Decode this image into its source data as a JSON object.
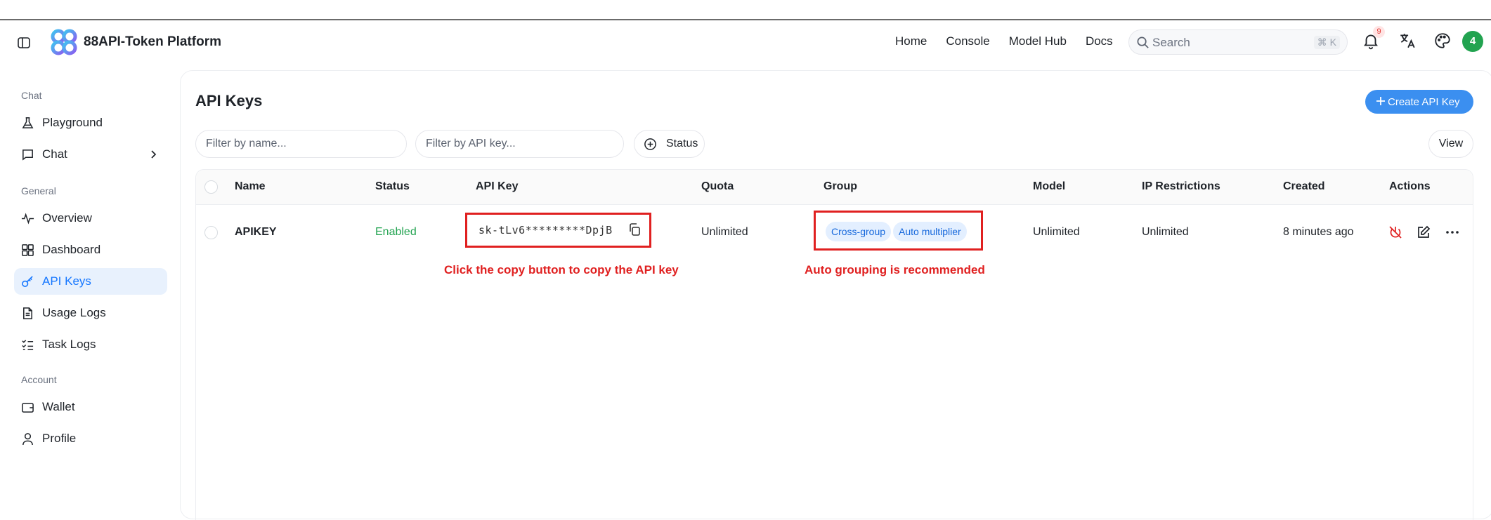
{
  "header": {
    "brand": "88API-Token Platform",
    "nav": [
      "Home",
      "Console",
      "Model Hub",
      "Docs"
    ],
    "search_placeholder": "Search",
    "search_shortcut": "⌘ K",
    "notification_count": "9",
    "avatar_initial": "4"
  },
  "sidebar": {
    "sections": [
      {
        "title": "Chat",
        "items": [
          "Playground",
          "Chat"
        ]
      },
      {
        "title": "General",
        "items": [
          "Overview",
          "Dashboard",
          "API Keys",
          "Usage Logs",
          "Task Logs"
        ]
      },
      {
        "title": "Account",
        "items": [
          "Wallet",
          "Profile"
        ]
      }
    ],
    "active_item": "API Keys"
  },
  "main": {
    "title": "API Keys",
    "create_label": "Create API Key",
    "filter_name_placeholder": "Filter by name...",
    "filter_key_placeholder": "Filter by API key...",
    "status_label": "Status",
    "view_label": "View",
    "columns": [
      "Name",
      "Status",
      "API Key",
      "Quota",
      "Group",
      "Model",
      "IP Restrictions",
      "Created",
      "Actions"
    ],
    "rows": [
      {
        "name": "APIKEY",
        "status": "Enabled",
        "api_key": "sk-tLv6*********DpjB",
        "quota": "Unlimited",
        "groups": [
          "Cross-group",
          "Auto multiplier"
        ],
        "model": "Unlimited",
        "ip_restrictions": "Unlimited",
        "created": "8 minutes ago"
      }
    ],
    "annotations": {
      "copy_hint": "Click the copy button to copy the API key",
      "group_hint": "Auto grouping is recommended"
    }
  },
  "colors": {
    "accent": "#3b8ff0",
    "enabled": "#22a350",
    "annotation": "#e02020",
    "tag_bg": "#e3efff",
    "tag_text": "#1668dc",
    "avatar": "#22a350"
  }
}
